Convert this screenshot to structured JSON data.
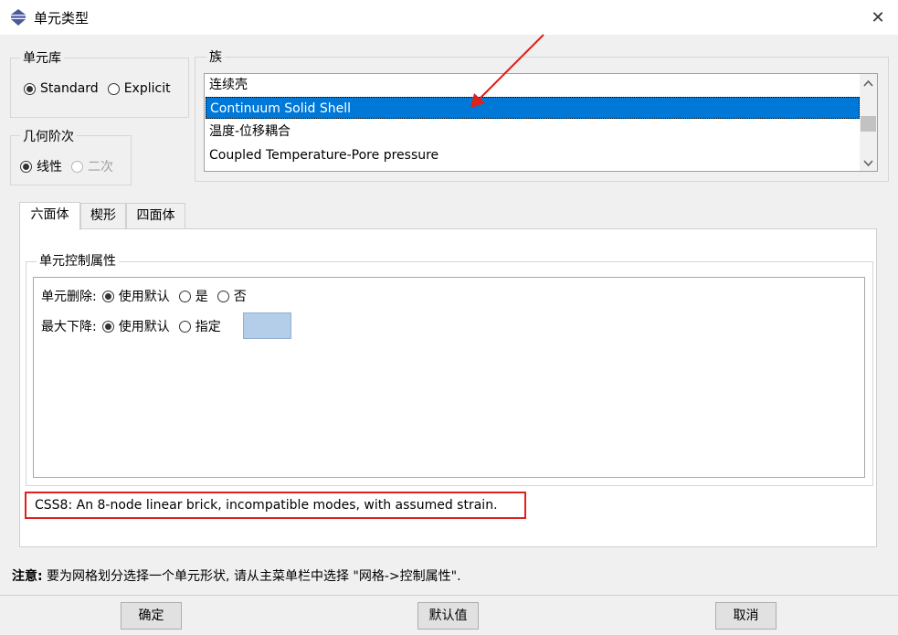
{
  "window": {
    "title": "单元类型",
    "close_glyph": "✕"
  },
  "library": {
    "label": "单元库",
    "options": [
      {
        "label": "Standard",
        "selected": true
      },
      {
        "label": "Explicit",
        "selected": false
      }
    ]
  },
  "order": {
    "label": "几何阶次",
    "options": [
      {
        "label": "线性",
        "selected": true,
        "disabled": false
      },
      {
        "label": "二次",
        "selected": false,
        "disabled": true
      }
    ]
  },
  "family": {
    "label": "族",
    "items": [
      "连续壳",
      "Continuum Solid Shell",
      "温度-位移耦合",
      "Coupled Temperature-Pore pressure"
    ],
    "selected_index": 1
  },
  "tabs": [
    {
      "label": "六面体",
      "active": true
    },
    {
      "label": "楔形",
      "active": false
    },
    {
      "label": "四面体",
      "active": false
    }
  ],
  "controls": {
    "label": "单元控制属性",
    "deletion": {
      "label": "单元删除:",
      "options": [
        "使用默认",
        "是",
        "否"
      ],
      "selected": 0
    },
    "degradation": {
      "label": "最大下降:",
      "options": [
        "使用默认",
        "指定"
      ],
      "selected": 0
    }
  },
  "description": "CSS8:  An 8-node linear brick, incompatible modes, with assumed strain.",
  "note": {
    "bold": "注意:",
    "text": "  要为网格划分选择一个单元形状, 请从主菜单栏中选择 \"网格->控制属性\"."
  },
  "buttons": {
    "ok": "确定",
    "defaults": "默认值",
    "cancel": "取消"
  },
  "annotation": {
    "color": "#e0201b"
  }
}
